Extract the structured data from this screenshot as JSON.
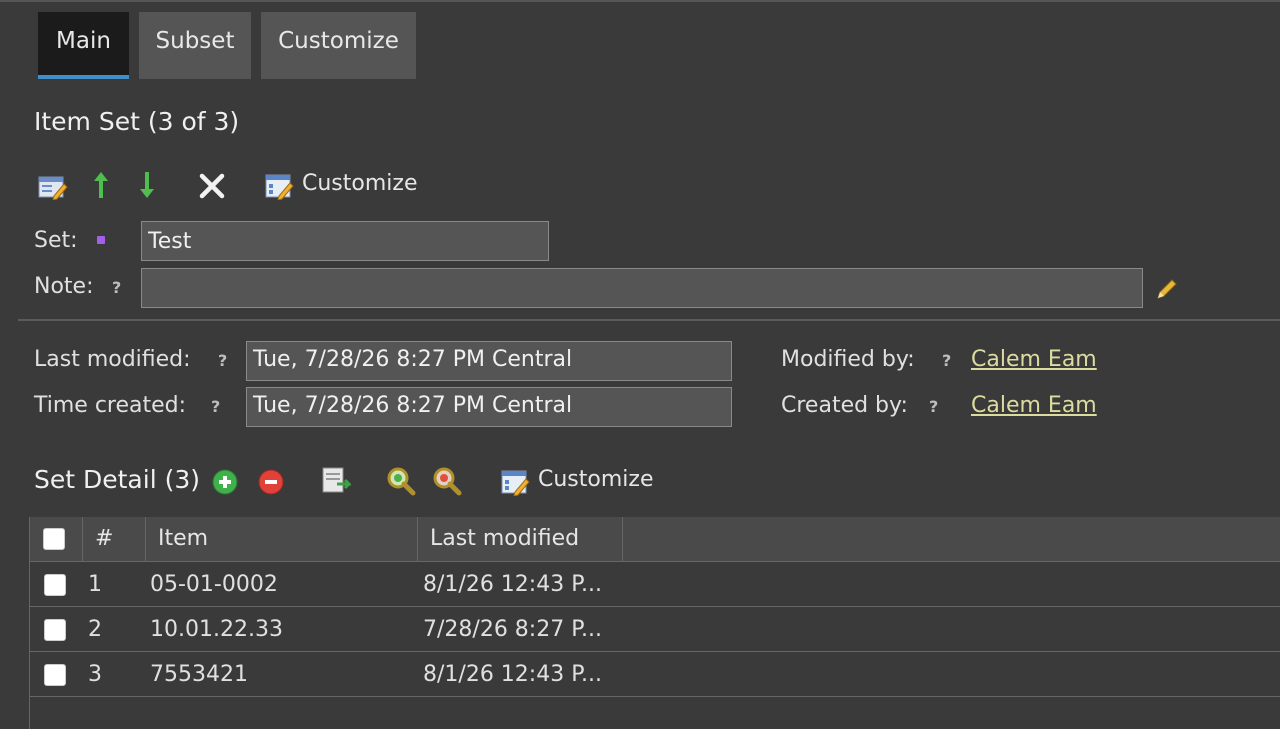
{
  "tabs": [
    {
      "label": "Main",
      "active": true
    },
    {
      "label": "Subset",
      "active": false
    },
    {
      "label": "Customize",
      "active": false
    }
  ],
  "item_set": {
    "title": "Item Set (3 of 3)",
    "toolbar": {
      "icons": [
        "edit-icon",
        "move-up-icon",
        "move-down-icon",
        "delete-icon",
        "customize-icon"
      ],
      "customize_label": "Customize"
    }
  },
  "form": {
    "set_label": "Set:",
    "set_value": "Test",
    "note_label": "Note:",
    "note_value": "",
    "help_glyph": "?"
  },
  "meta": {
    "last_modified_label": "Last modified:",
    "last_modified_value": "Tue, 7/28/26 8:27 PM Central",
    "time_created_label": "Time created:",
    "time_created_value": "Tue, 7/28/26 8:27 PM Central",
    "modified_by_label": "Modified by:",
    "modified_by_value": "Calem Eam",
    "created_by_label": "Created by:",
    "created_by_value": "Calem Eam"
  },
  "set_detail": {
    "title": "Set Detail (3)",
    "customize_label": "Customize",
    "toolbar_icons": [
      "add-icon",
      "remove-icon",
      "export-icon",
      "search-icon",
      "clear-search-icon",
      "customize-icon"
    ],
    "columns": [
      "#",
      "Item",
      "Last modified"
    ],
    "rows": [
      {
        "num": "1",
        "item": "05-01-0002",
        "last_modified": "8/1/26 12:43 P..."
      },
      {
        "num": "2",
        "item": "10.01.22.33",
        "last_modified": "7/28/26 8:27 P..."
      },
      {
        "num": "3",
        "item": "7553421",
        "last_modified": "8/1/26 12:43 P..."
      }
    ]
  },
  "colors": {
    "background": "#3a3a3a",
    "active_tab_underline": "#3f8fc8",
    "link": "#dcdca0",
    "required_marker": "#a060e8"
  }
}
